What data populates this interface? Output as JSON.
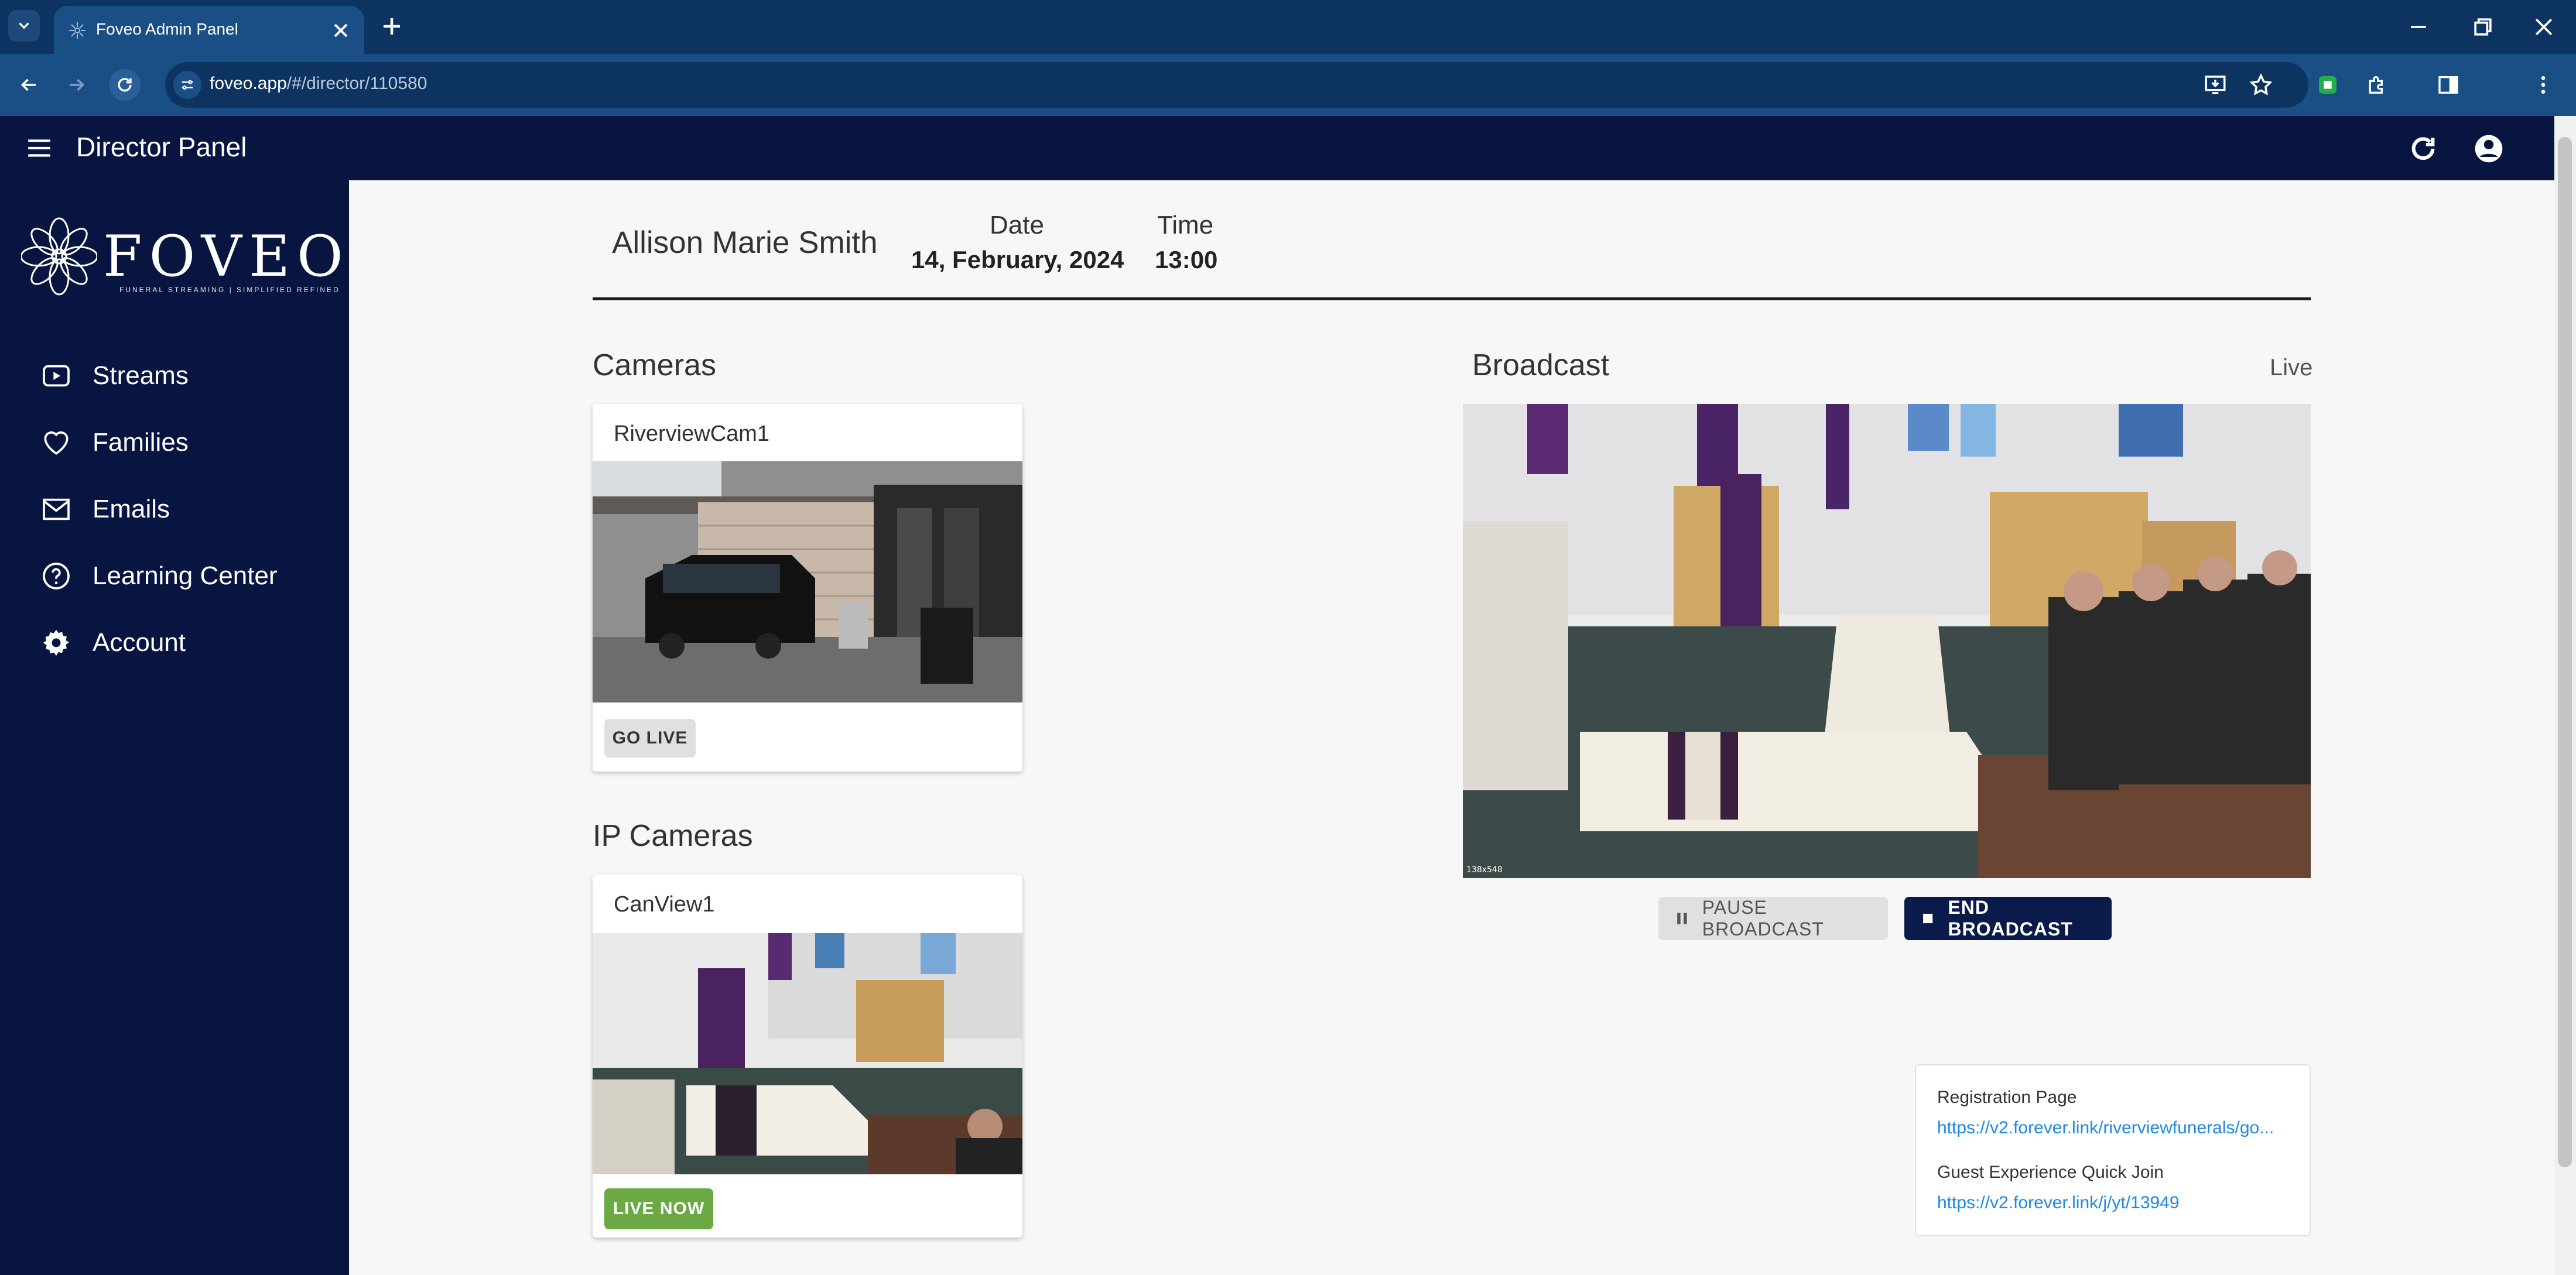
{
  "browser": {
    "tab_title": "Foveo Admin Panel",
    "url_host": "foveo.app",
    "url_path": "/#/director/110580"
  },
  "header": {
    "title": "Director Panel"
  },
  "sidebar": {
    "logo_text": "FOVEO",
    "logo_tagline": "FUNERAL STREAMING | SIMPLIFIED REFINED",
    "items": [
      {
        "label": "Streams",
        "icon": "play-icon"
      },
      {
        "label": "Families",
        "icon": "heart-icon"
      },
      {
        "label": "Emails",
        "icon": "mail-icon"
      },
      {
        "label": "Learning Center",
        "icon": "help-icon"
      },
      {
        "label": "Account",
        "icon": "gear-icon"
      }
    ]
  },
  "event": {
    "name": "Allison Marie Smith",
    "date_label": "Date",
    "date_value": "14, February, 2024",
    "time_label": "Time",
    "time_value": "13:00"
  },
  "cameras": {
    "title": "Cameras",
    "items": [
      {
        "name": "RiverviewCam1",
        "button": "GO LIVE"
      }
    ]
  },
  "ip_cameras": {
    "title": "IP Cameras",
    "items": [
      {
        "name": "CanView1",
        "button": "LIVE NOW"
      }
    ]
  },
  "broadcast": {
    "title": "Broadcast",
    "status": "Live",
    "pause_label": "PAUSE BROADCAST",
    "end_label": "END BROADCAST",
    "overlay_text": "138x548"
  },
  "links": {
    "registration_label": "Registration Page",
    "registration_url": "https://v2.forever.link/riverviewfunerals/go...",
    "guest_label": "Guest Experience Quick Join",
    "guest_url": "https://v2.forever.link/j/yt/13949"
  },
  "colors": {
    "app_navy": "#071540",
    "browser_blue": "#1a4f86",
    "live_green": "#6aa943",
    "link_blue": "#1e88e5"
  }
}
